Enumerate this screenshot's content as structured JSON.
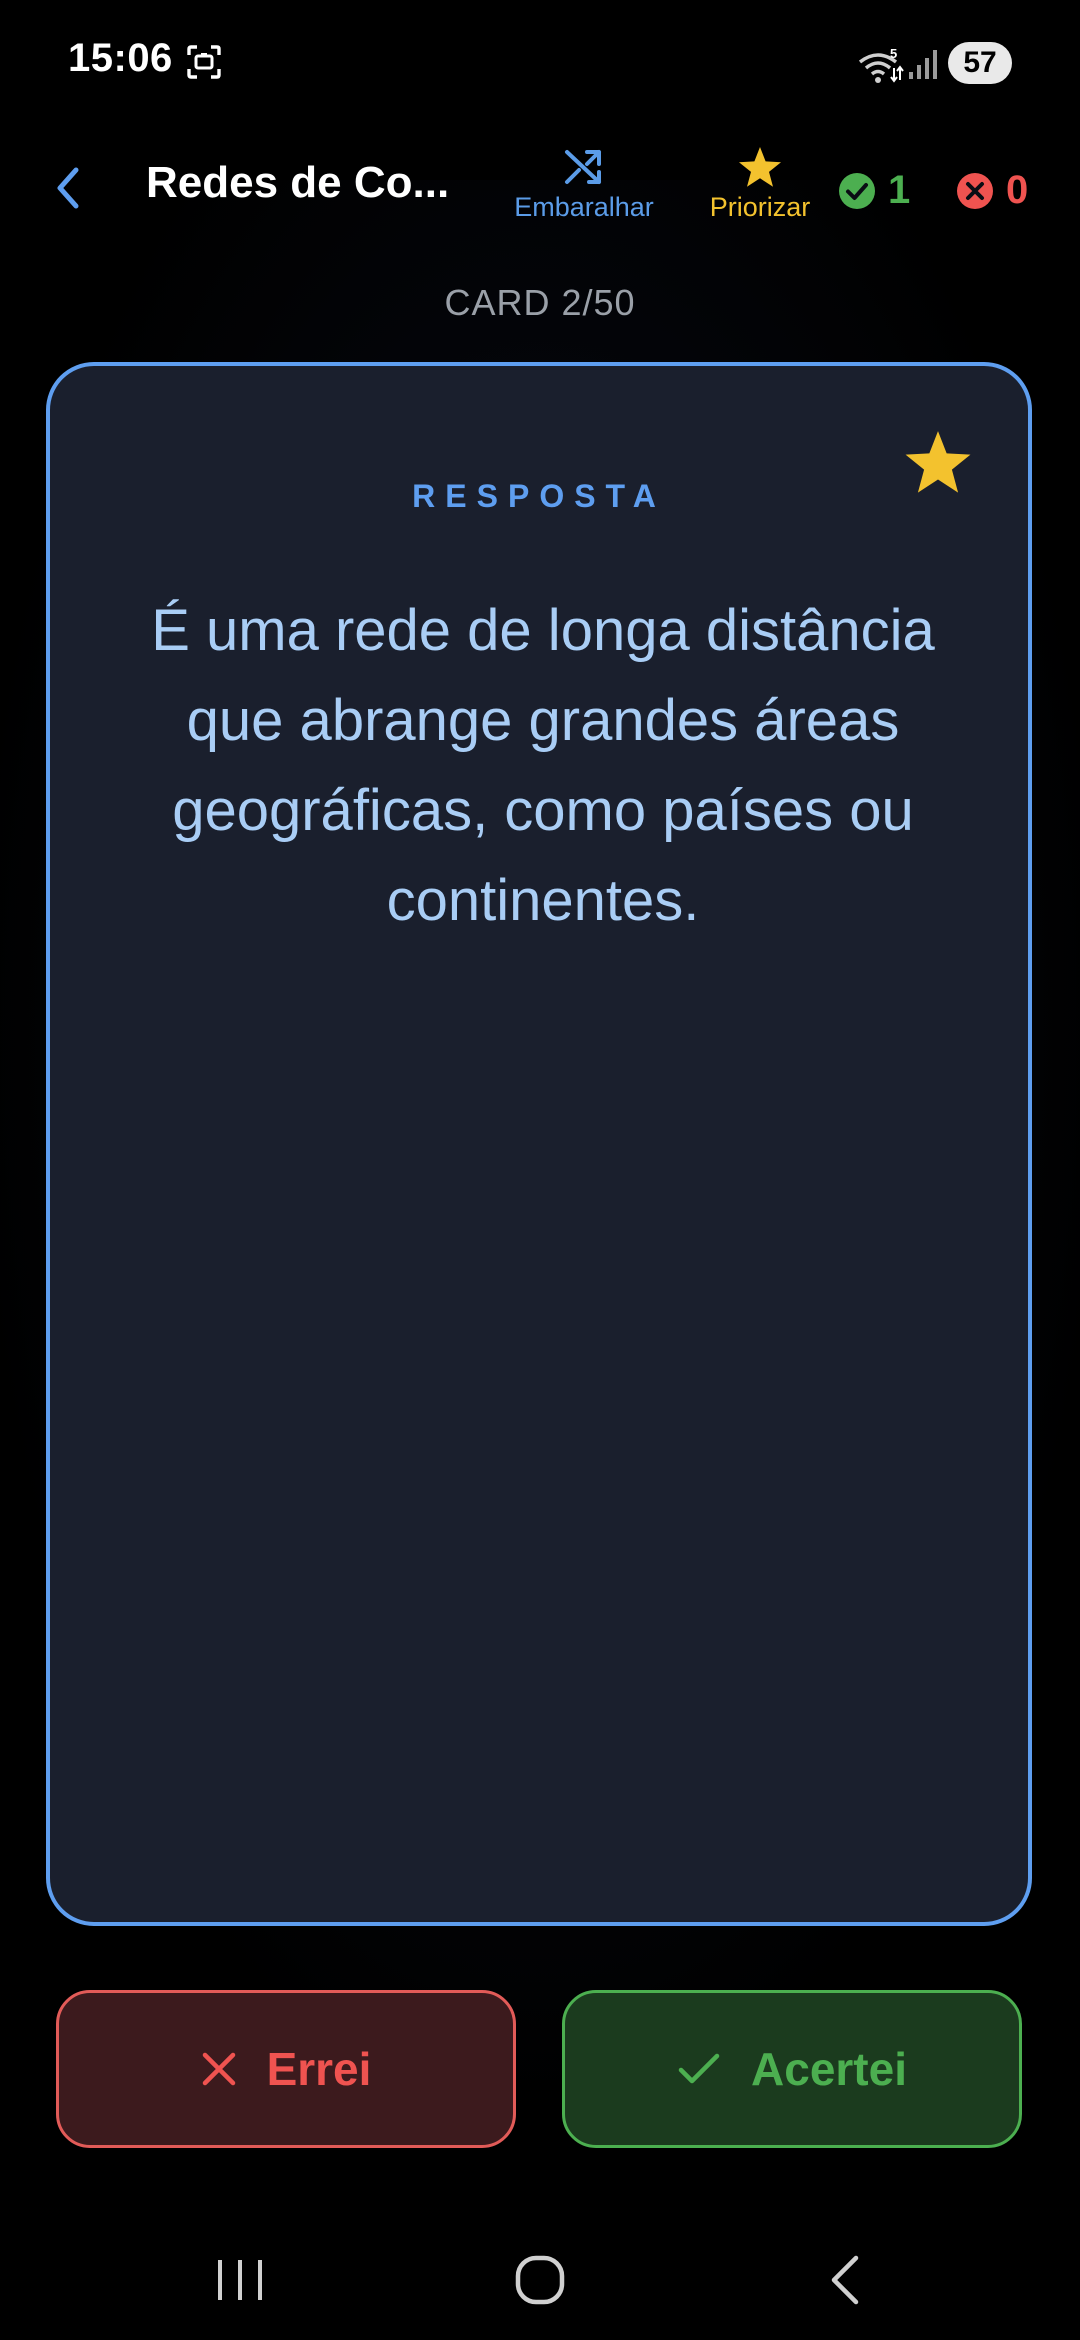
{
  "status_bar": {
    "time": "15:06",
    "wifi_badge": "5",
    "battery": "57"
  },
  "app_bar": {
    "title": "Redes de Co...",
    "shuffle_label": "Embaralhar",
    "prioritize_label": "Priorizar",
    "correct_count": "1",
    "wrong_count": "0"
  },
  "counter": "CARD 2/50",
  "card": {
    "side_label": "RESPOSTA",
    "text": "É uma rede de longa distância que abrange grandes áreas geográficas, como países ou continentes.",
    "favorited": true
  },
  "buttons": {
    "wrong_label": "Errei",
    "correct_label": "Acertei"
  },
  "colors": {
    "accent_blue": "#5e9ef0",
    "star_yellow": "#f3c22e",
    "correct_green": "#4caf50",
    "wrong_red": "#ef5350",
    "card_bg": "#1a1f2d"
  },
  "icons": {
    "back": "chevron-left-icon",
    "shuffle": "shuffle-icon",
    "prioritize": "star-icon",
    "correct": "check-circle-icon",
    "wrong": "x-circle-icon"
  }
}
